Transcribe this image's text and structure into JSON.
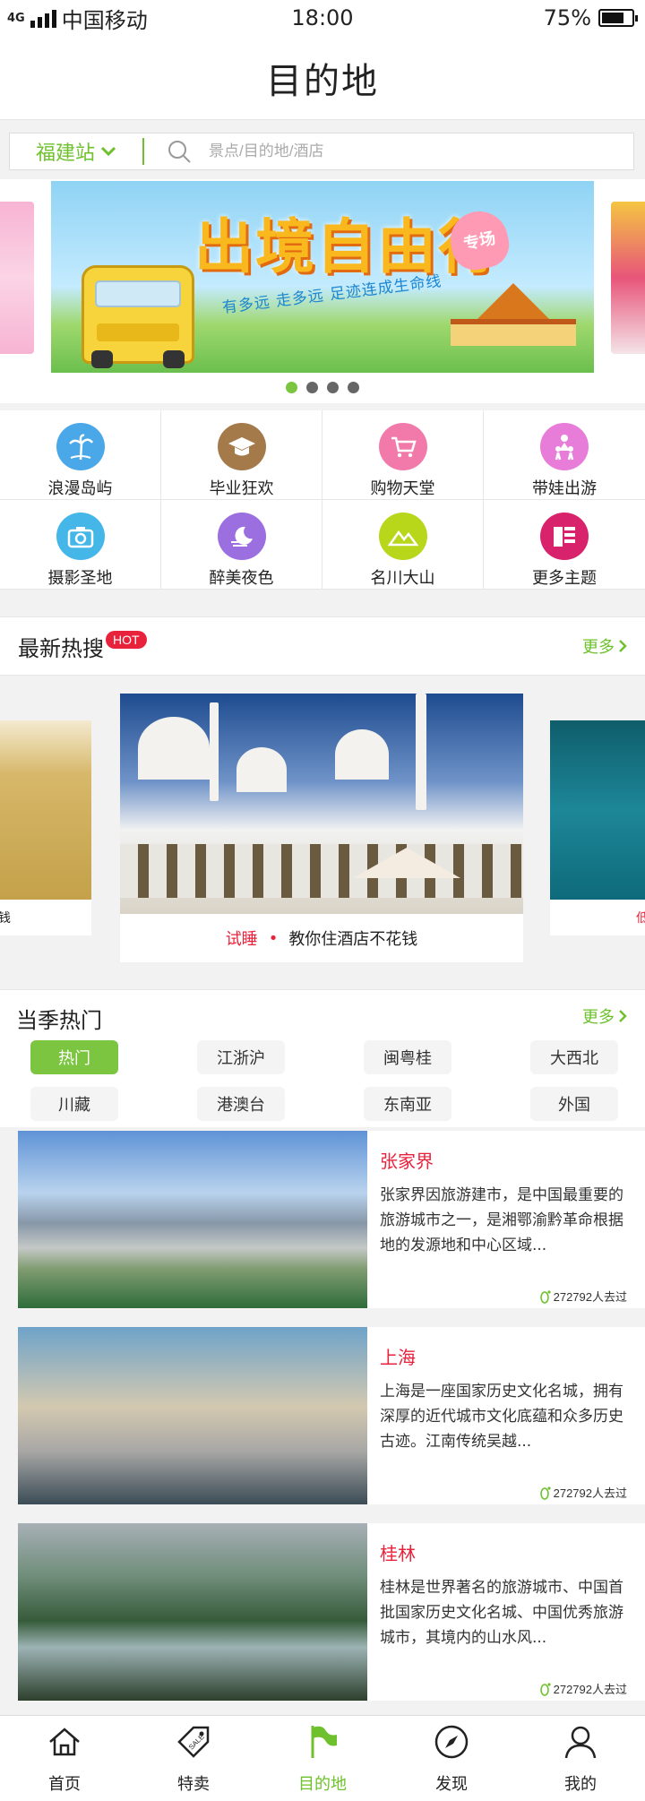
{
  "status": {
    "carrier": "中国移动",
    "network": "4G",
    "time": "18:00",
    "battery": "75%",
    "battery_level": 0.75
  },
  "header": {
    "title": "目的地"
  },
  "search": {
    "city": "福建站",
    "placeholder": "景点/目的地/酒店"
  },
  "banner": {
    "title": "出境自由行",
    "badge": "专场",
    "subtitle": "有多远 走多远 足迹连成生命线",
    "active_index": 0,
    "dot_count": 4
  },
  "categories": [
    {
      "label": "浪漫岛屿",
      "icon": "palm-tree-icon",
      "color": "#4aa8e8"
    },
    {
      "label": "毕业狂欢",
      "icon": "graduation-cap-icon",
      "color": "#a57a4a"
    },
    {
      "label": "购物天堂",
      "icon": "shopping-cart-icon",
      "color": "#f27aaa"
    },
    {
      "label": "带娃出游",
      "icon": "family-icon",
      "color": "#e77dd8"
    },
    {
      "label": "摄影圣地",
      "icon": "camera-icon",
      "color": "#44b6e8"
    },
    {
      "label": "醉美夜色",
      "icon": "moon-icon",
      "color": "#9b6fe0"
    },
    {
      "label": "名川大山",
      "icon": "mountain-icon",
      "color": "#b8d61a"
    },
    {
      "label": "更多主题",
      "icon": "list-icon",
      "color": "#d8226b"
    }
  ],
  "hot": {
    "title": "最新热搜",
    "badge": "HOT",
    "more": "更多",
    "left_caption": "钱",
    "main_caption": {
      "tag": "试睡",
      "text": "教你住酒店不花钱"
    },
    "right_caption": "低"
  },
  "season": {
    "title": "当季热门",
    "more": "更多",
    "chips": [
      "热门",
      "江浙沪",
      "闽粤桂",
      "大西北",
      "川藏",
      "港澳台",
      "东南亚",
      "外国"
    ],
    "active_chip": 0
  },
  "destinations": [
    {
      "name": "张家界",
      "desc": "张家界因旅游建市，是中国最重要的旅游城市之一，是湘鄂渝黔革命根据地的发源地和中心区域...",
      "visits": "272792人去过"
    },
    {
      "name": "上海",
      "desc": "上海是一座国家历史文化名城，拥有深厚的近代城市文化底蕴和众多历史古迹。江南传统吴越...",
      "visits": "272792人去过"
    },
    {
      "name": "桂林",
      "desc": "桂林是世界著名的旅游城市、中国首批国家历史文化名城、中国优秀旅游城市，其境内的山水风...",
      "visits": "272792人去过"
    }
  ],
  "tabs": [
    {
      "label": "首页",
      "icon": "home-icon"
    },
    {
      "label": "特卖",
      "icon": "sale-tag-icon"
    },
    {
      "label": "目的地",
      "icon": "flag-icon"
    },
    {
      "label": "发现",
      "icon": "compass-icon"
    },
    {
      "label": "我的",
      "icon": "user-icon"
    }
  ],
  "active_tab": 2,
  "colors": {
    "accent": "#6ec12c",
    "hot": "#e8223b"
  }
}
